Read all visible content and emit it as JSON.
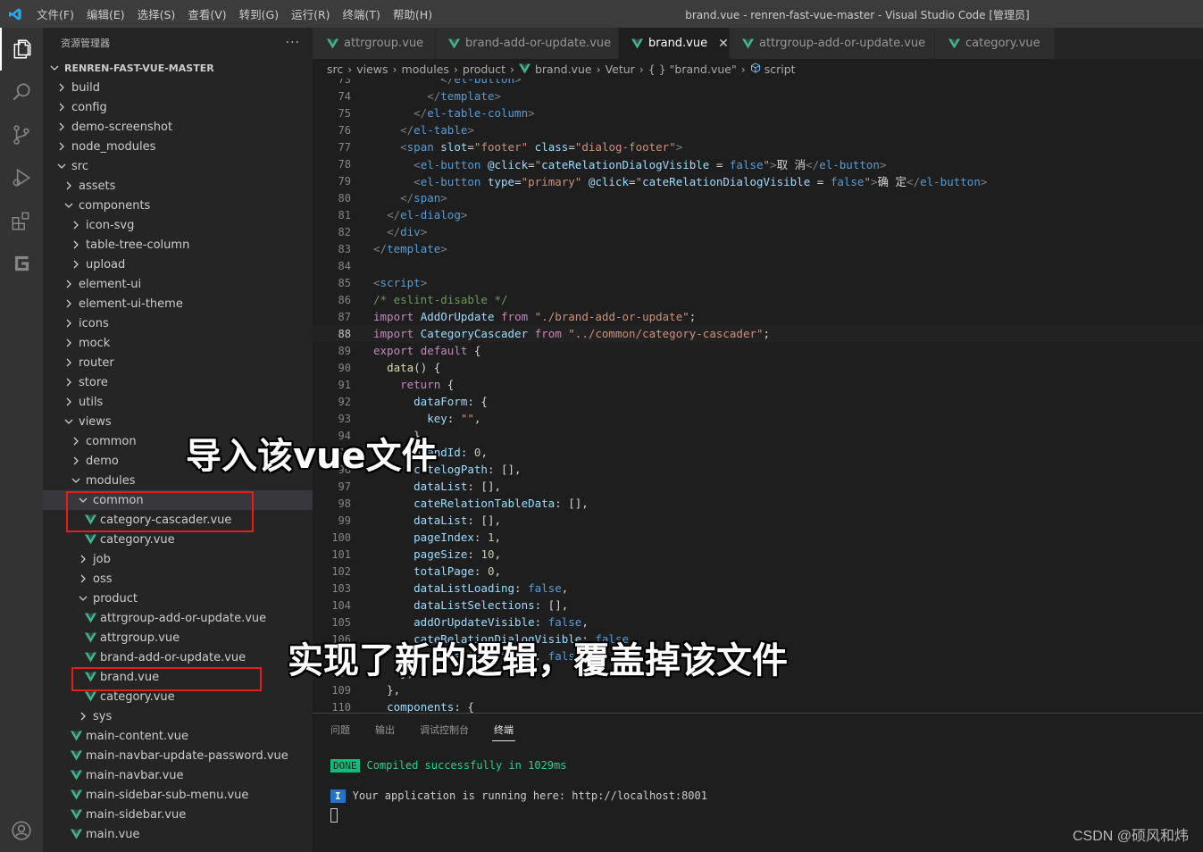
{
  "titlebar": {
    "menu": [
      "文件(F)",
      "编辑(E)",
      "选择(S)",
      "查看(V)",
      "转到(G)",
      "运行(R)",
      "终端(T)",
      "帮助(H)"
    ],
    "window_title": "brand.vue - renren-fast-vue-master - Visual Studio Code [管理员]"
  },
  "sidebar": {
    "header": "资源管理器",
    "more": "···",
    "root": "RENREN-FAST-VUE-MASTER",
    "tree": [
      {
        "label": "build",
        "type": "folder",
        "open": false,
        "depth": 0
      },
      {
        "label": "config",
        "type": "folder",
        "open": false,
        "depth": 0
      },
      {
        "label": "demo-screenshot",
        "type": "folder",
        "open": false,
        "depth": 0
      },
      {
        "label": "node_modules",
        "type": "folder",
        "open": false,
        "depth": 0
      },
      {
        "label": "src",
        "type": "folder",
        "open": true,
        "depth": 0
      },
      {
        "label": "assets",
        "type": "folder",
        "open": false,
        "depth": 1
      },
      {
        "label": "components",
        "type": "folder",
        "open": true,
        "depth": 1
      },
      {
        "label": "icon-svg",
        "type": "folder",
        "open": false,
        "depth": 2
      },
      {
        "label": "table-tree-column",
        "type": "folder",
        "open": false,
        "depth": 2
      },
      {
        "label": "upload",
        "type": "folder",
        "open": false,
        "depth": 2
      },
      {
        "label": "element-ui",
        "type": "folder",
        "open": false,
        "depth": 1
      },
      {
        "label": "element-ui-theme",
        "type": "folder",
        "open": false,
        "depth": 1
      },
      {
        "label": "icons",
        "type": "folder",
        "open": false,
        "depth": 1
      },
      {
        "label": "mock",
        "type": "folder",
        "open": false,
        "depth": 1
      },
      {
        "label": "router",
        "type": "folder",
        "open": false,
        "depth": 1
      },
      {
        "label": "store",
        "type": "folder",
        "open": false,
        "depth": 1
      },
      {
        "label": "utils",
        "type": "folder",
        "open": false,
        "depth": 1
      },
      {
        "label": "views",
        "type": "folder",
        "open": true,
        "depth": 1
      },
      {
        "label": "common",
        "type": "folder",
        "open": false,
        "depth": 2
      },
      {
        "label": "demo",
        "type": "folder",
        "open": false,
        "depth": 2
      },
      {
        "label": "modules",
        "type": "folder",
        "open": true,
        "depth": 2
      },
      {
        "label": "common",
        "type": "folder",
        "open": true,
        "depth": 3,
        "selected": true
      },
      {
        "label": "category-cascader.vue",
        "type": "vue",
        "depth": 4
      },
      {
        "label": "category.vue",
        "type": "vue",
        "depth": 4
      },
      {
        "label": "job",
        "type": "folder",
        "open": false,
        "depth": 3
      },
      {
        "label": "oss",
        "type": "folder",
        "open": false,
        "depth": 3
      },
      {
        "label": "product",
        "type": "folder",
        "open": true,
        "depth": 3
      },
      {
        "label": "attrgroup-add-or-update.vue",
        "type": "vue",
        "depth": 4
      },
      {
        "label": "attrgroup.vue",
        "type": "vue",
        "depth": 4
      },
      {
        "label": "brand-add-or-update.vue",
        "type": "vue",
        "depth": 4
      },
      {
        "label": "brand.vue",
        "type": "vue",
        "depth": 4
      },
      {
        "label": "category.vue",
        "type": "vue",
        "depth": 4
      },
      {
        "label": "sys",
        "type": "folder",
        "open": false,
        "depth": 3
      },
      {
        "label": "main-content.vue",
        "type": "vue",
        "depth": 2
      },
      {
        "label": "main-navbar-update-password.vue",
        "type": "vue",
        "depth": 2
      },
      {
        "label": "main-navbar.vue",
        "type": "vue",
        "depth": 2
      },
      {
        "label": "main-sidebar-sub-menu.vue",
        "type": "vue",
        "depth": 2
      },
      {
        "label": "main-sidebar.vue",
        "type": "vue",
        "depth": 2
      },
      {
        "label": "main.vue",
        "type": "vue",
        "depth": 2
      }
    ]
  },
  "tabs": [
    {
      "label": "attrgroup.vue",
      "active": false
    },
    {
      "label": "brand-add-or-update.vue",
      "active": false
    },
    {
      "label": "brand.vue",
      "active": true,
      "close": "✕"
    },
    {
      "label": "attrgroup-add-or-update.vue",
      "active": false
    },
    {
      "label": "category.vue",
      "active": false
    }
  ],
  "breadcrumb": [
    "src",
    "views",
    "modules",
    "product",
    "brand.vue",
    "Vetur",
    "{ } \"brand.vue\"",
    "script"
  ],
  "editor": {
    "current_line": 88,
    "lines": [
      {
        "n": "73",
        "html": "          <span class='t-tag'>&lt;/</span><span class='t-tn'>el-button</span><span class='t-tag'>&gt;</span>"
      },
      {
        "n": "74",
        "html": "        <span class='t-tag'>&lt;/</span><span class='t-tn'>template</span><span class='t-tag'>&gt;</span>"
      },
      {
        "n": "75",
        "html": "      <span class='t-tag'>&lt;/</span><span class='t-tn'>el-table-column</span><span class='t-tag'>&gt;</span>"
      },
      {
        "n": "76",
        "html": "    <span class='t-tag'>&lt;/</span><span class='t-tn'>el-table</span><span class='t-tag'>&gt;</span>"
      },
      {
        "n": "77",
        "html": "    <span class='t-tag'>&lt;</span><span class='t-tn'>span</span> <span class='t-at'>slot</span>=<span class='t-st'>\"footer\"</span> <span class='t-at'>class</span>=<span class='t-st'>\"dialog-footer\"</span><span class='t-tag'>&gt;</span>"
      },
      {
        "n": "78",
        "html": "      <span class='t-tag'>&lt;</span><span class='t-tn'>el-button</span> <span class='t-at'>@click</span>=<span class='t-st'>\"</span><span class='t-id'>cateRelationDialogVisible</span> = <span class='t-kw'>false</span><span class='t-st'>\"</span><span class='t-tag'>&gt;</span>取 消<span class='t-tag'>&lt;/</span><span class='t-tn'>el-button</span><span class='t-tag'>&gt;</span>"
      },
      {
        "n": "79",
        "html": "      <span class='t-tag'>&lt;</span><span class='t-tn'>el-button</span> <span class='t-at'>type</span>=<span class='t-st'>\"primary\"</span> <span class='t-at'>@click</span>=<span class='t-st'>\"</span><span class='t-id'>cateRelationDialogVisible</span> = <span class='t-kw'>false</span><span class='t-st'>\"</span><span class='t-tag'>&gt;</span>确 定<span class='t-tag'>&lt;/</span><span class='t-tn'>el-button</span><span class='t-tag'>&gt;</span>"
      },
      {
        "n": "80",
        "html": "    <span class='t-tag'>&lt;/</span><span class='t-tn'>span</span><span class='t-tag'>&gt;</span>"
      },
      {
        "n": "81",
        "html": "  <span class='t-tag'>&lt;/</span><span class='t-tn'>el-dialog</span><span class='t-tag'>&gt;</span>"
      },
      {
        "n": "82",
        "html": "  <span class='t-tag'>&lt;/</span><span class='t-tn'>div</span><span class='t-tag'>&gt;</span>"
      },
      {
        "n": "83",
        "html": "<span class='t-tag'>&lt;/</span><span class='t-tn'>template</span><span class='t-tag'>&gt;</span>"
      },
      {
        "n": "84",
        "html": ""
      },
      {
        "n": "85",
        "html": "<span class='t-tag'>&lt;</span><span class='t-tn'>script</span><span class='t-tag'>&gt;</span>"
      },
      {
        "n": "86",
        "html": "<span class='t-cm'>/* eslint-disable */</span>"
      },
      {
        "n": "87",
        "html": "<span class='t-ck'>import</span> <span class='t-id'>AddOrUpdate</span> <span class='t-ck'>from</span> <span class='t-st'>\"./brand-add-or-update\"</span>;"
      },
      {
        "n": "88",
        "html": "<span class='t-ck'>import</span> <span class='t-id'>CategoryCascader</span> <span class='t-ck'>from</span> <span class='t-st'>\"../common/category-cascader\"</span>;"
      },
      {
        "n": "89",
        "html": "<span class='t-ck'>export</span> <span class='t-ck'>default</span> {"
      },
      {
        "n": "90",
        "html": "  <span class='t-fn'>data</span>() {"
      },
      {
        "n": "91",
        "html": "    <span class='t-ck'>return</span> {"
      },
      {
        "n": "92",
        "html": "      <span class='t-pr'>dataForm</span>: {"
      },
      {
        "n": "93",
        "html": "        <span class='t-pr'>key</span>: <span class='t-st'>\"\"</span>,"
      },
      {
        "n": "94",
        "html": "      },"
      },
      {
        "n": "95",
        "html": "      <span class='t-pr'>brandId</span>: <span class='t-nm'>0</span>,"
      },
      {
        "n": "96",
        "html": "      <span class='t-pr'>catelogPath</span>: [],"
      },
      {
        "n": "97",
        "html": "      <span class='t-pr'>dataList</span>: [],"
      },
      {
        "n": "98",
        "html": "      <span class='t-pr'>cateRelationTableData</span>: [],"
      },
      {
        "n": "99",
        "html": "      <span class='t-pr'>dataList</span>: [],"
      },
      {
        "n": "100",
        "html": "      <span class='t-pr'>pageIndex</span>: <span class='t-nm'>1</span>,"
      },
      {
        "n": "101",
        "html": "      <span class='t-pr'>pageSize</span>: <span class='t-nm'>10</span>,"
      },
      {
        "n": "102",
        "html": "      <span class='t-pr'>totalPage</span>: <span class='t-nm'>0</span>,"
      },
      {
        "n": "103",
        "html": "      <span class='t-pr'>dataListLoading</span>: <span class='t-kw'>false</span>,"
      },
      {
        "n": "104",
        "html": "      <span class='t-pr'>dataListSelections</span>: [],"
      },
      {
        "n": "105",
        "html": "      <span class='t-pr'>addOrUpdateVisible</span>: <span class='t-kw'>false</span>,"
      },
      {
        "n": "106",
        "html": "      <span class='t-pr'>cateRelationDialogVisible</span>: <span class='t-kw'>false</span>,"
      },
      {
        "n": "107",
        "html": "      <span class='t-pr'>dataListSelectable</span>: <span class='t-kw'>false</span>,"
      },
      {
        "n": "108",
        "html": "    };"
      },
      {
        "n": "109",
        "html": "  },"
      },
      {
        "n": "110",
        "html": "  <span class='t-pr'>components</span>: {"
      }
    ]
  },
  "panel": {
    "tabs": [
      {
        "label": "问题",
        "active": false
      },
      {
        "label": "输出",
        "active": false
      },
      {
        "label": "调试控制台",
        "active": false
      },
      {
        "label": "终端",
        "active": true
      }
    ],
    "done_badge": "DONE",
    "compiled": "Compiled successfully in 1029ms",
    "info_badge": "I",
    "running": "Your application is running here: http://localhost:8001"
  },
  "annotations": {
    "import_note": "导入该vue文件",
    "override_note": "实现了新的逻辑，覆盖掉该文件"
  },
  "watermark": "CSDN @硕风和炜",
  "colors": {
    "vue_green": "#41b883",
    "annotation_red": "#e02020"
  }
}
